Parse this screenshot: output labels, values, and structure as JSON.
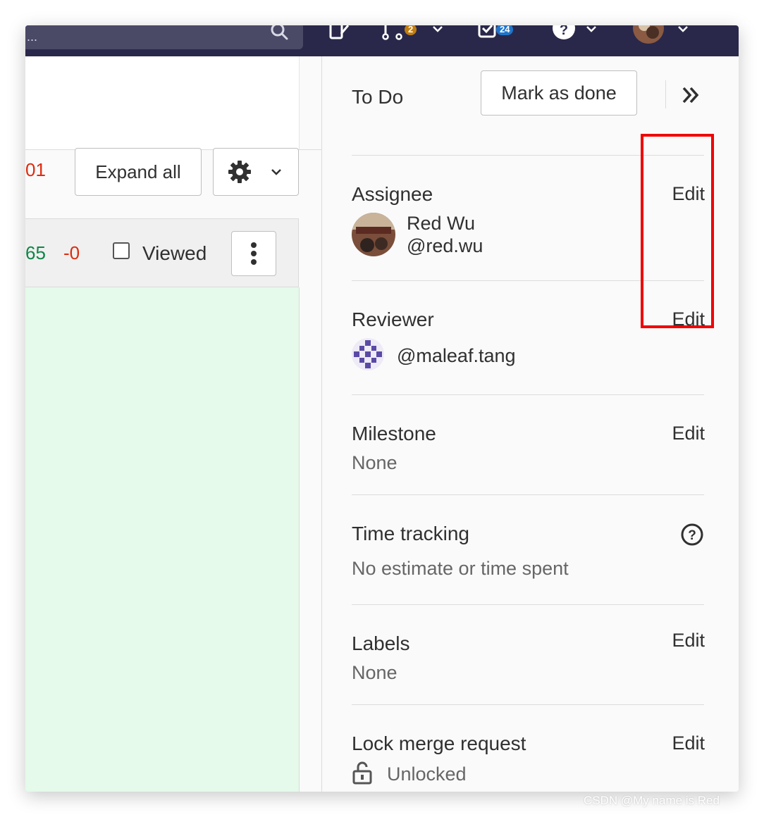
{
  "topnav": {
    "search_placeholder": "...",
    "merge_requests_count": "2",
    "todos_count": "24"
  },
  "diff_toolbar": {
    "changes_count": "01",
    "expand_all_label": "Expand all",
    "settings_icon": "gear-icon"
  },
  "file_header": {
    "additions": "65",
    "deletions": "-0",
    "viewed_label": "Viewed",
    "viewed_checked": false
  },
  "sidebar": {
    "todo_label": "To Do",
    "mark_done_label": "Mark as done",
    "assignee": {
      "title": "Assignee",
      "edit_label": "Edit",
      "name": "Red Wu",
      "username": "@red.wu"
    },
    "reviewer": {
      "title": "Reviewer",
      "edit_label": "Edit",
      "username": "@maleaf.tang"
    },
    "milestone": {
      "title": "Milestone",
      "edit_label": "Edit",
      "value": "None"
    },
    "time_tracking": {
      "title": "Time tracking",
      "value": "No estimate or time spent"
    },
    "labels": {
      "title": "Labels",
      "edit_label": "Edit",
      "value": "None"
    },
    "lock": {
      "title": "Lock merge request",
      "edit_label": "Edit",
      "value": "Unlocked"
    }
  },
  "watermark": "CSDN @My name is Red",
  "colors": {
    "nav_bg": "#29284a",
    "added": "#108548",
    "removed": "#dd2b0e",
    "diff_bg": "#e5faea",
    "highlight": "#f00000",
    "mr_badge": "#c17d10",
    "todo_badge": "#1f75cb"
  }
}
